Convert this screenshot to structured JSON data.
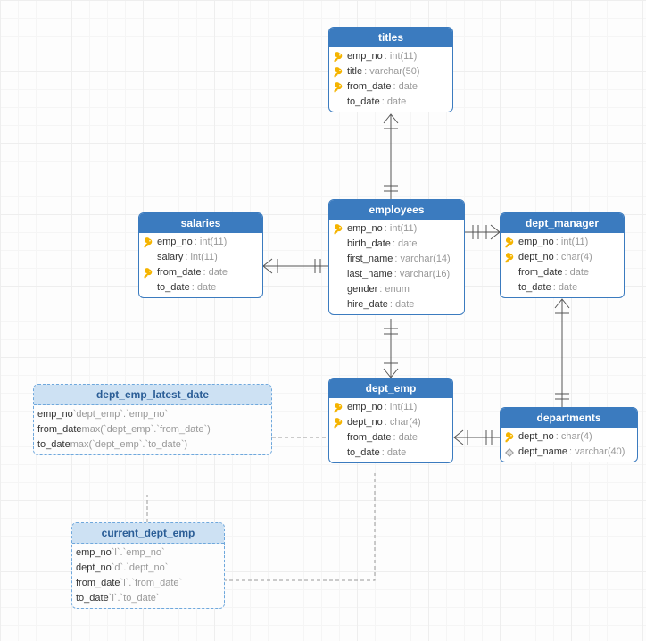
{
  "entities": {
    "titles": {
      "name": "titles",
      "columns": [
        {
          "icon": "key",
          "name": "emp_no",
          "type": "int(11)"
        },
        {
          "icon": "key",
          "name": "title",
          "type": "varchar(50)"
        },
        {
          "icon": "key",
          "name": "from_date",
          "type": "date"
        },
        {
          "icon": "",
          "name": "to_date",
          "type": "date"
        }
      ]
    },
    "salaries": {
      "name": "salaries",
      "columns": [
        {
          "icon": "key",
          "name": "emp_no",
          "type": "int(11)"
        },
        {
          "icon": "",
          "name": "salary",
          "type": "int(11)"
        },
        {
          "icon": "key",
          "name": "from_date",
          "type": "date"
        },
        {
          "icon": "",
          "name": "to_date",
          "type": "date"
        }
      ]
    },
    "employees": {
      "name": "employees",
      "columns": [
        {
          "icon": "key",
          "name": "emp_no",
          "type": "int(11)"
        },
        {
          "icon": "",
          "name": "birth_date",
          "type": "date"
        },
        {
          "icon": "",
          "name": "first_name",
          "type": "varchar(14)"
        },
        {
          "icon": "",
          "name": "last_name",
          "type": "varchar(16)"
        },
        {
          "icon": "",
          "name": "gender",
          "type": "enum"
        },
        {
          "icon": "",
          "name": "hire_date",
          "type": "date"
        }
      ]
    },
    "dept_manager": {
      "name": "dept_manager",
      "columns": [
        {
          "icon": "key",
          "name": "emp_no",
          "type": "int(11)"
        },
        {
          "icon": "key",
          "name": "dept_no",
          "type": "char(4)"
        },
        {
          "icon": "",
          "name": "from_date",
          "type": "date"
        },
        {
          "icon": "",
          "name": "to_date",
          "type": "date"
        }
      ]
    },
    "dept_emp": {
      "name": "dept_emp",
      "columns": [
        {
          "icon": "key",
          "name": "emp_no",
          "type": "int(11)"
        },
        {
          "icon": "key",
          "name": "dept_no",
          "type": "char(4)"
        },
        {
          "icon": "",
          "name": "from_date",
          "type": "date"
        },
        {
          "icon": "",
          "name": "to_date",
          "type": "date"
        }
      ]
    },
    "departments": {
      "name": "departments",
      "columns": [
        {
          "icon": "key",
          "name": "dept_no",
          "type": "char(4)"
        },
        {
          "icon": "diamond",
          "name": "dept_name",
          "type": "varchar(40)"
        }
      ]
    }
  },
  "views": {
    "dept_emp_latest_date": {
      "name": "dept_emp_latest_date",
      "columns": [
        {
          "name": "emp_no",
          "expr": "`dept_emp`.`emp_no`"
        },
        {
          "name": "from_date",
          "expr": "max(`dept_emp`.`from_date`)"
        },
        {
          "name": "to_date",
          "expr": "max(`dept_emp`.`to_date`)"
        }
      ]
    },
    "current_dept_emp": {
      "name": "current_dept_emp",
      "columns": [
        {
          "name": "emp_no",
          "expr": "`l`.`emp_no`"
        },
        {
          "name": "dept_no",
          "expr": "`d`.`dept_no`"
        },
        {
          "name": "from_date",
          "expr": "`l`.`from_date`"
        },
        {
          "name": "to_date",
          "expr": "`l`.`to_date`"
        }
      ]
    }
  }
}
